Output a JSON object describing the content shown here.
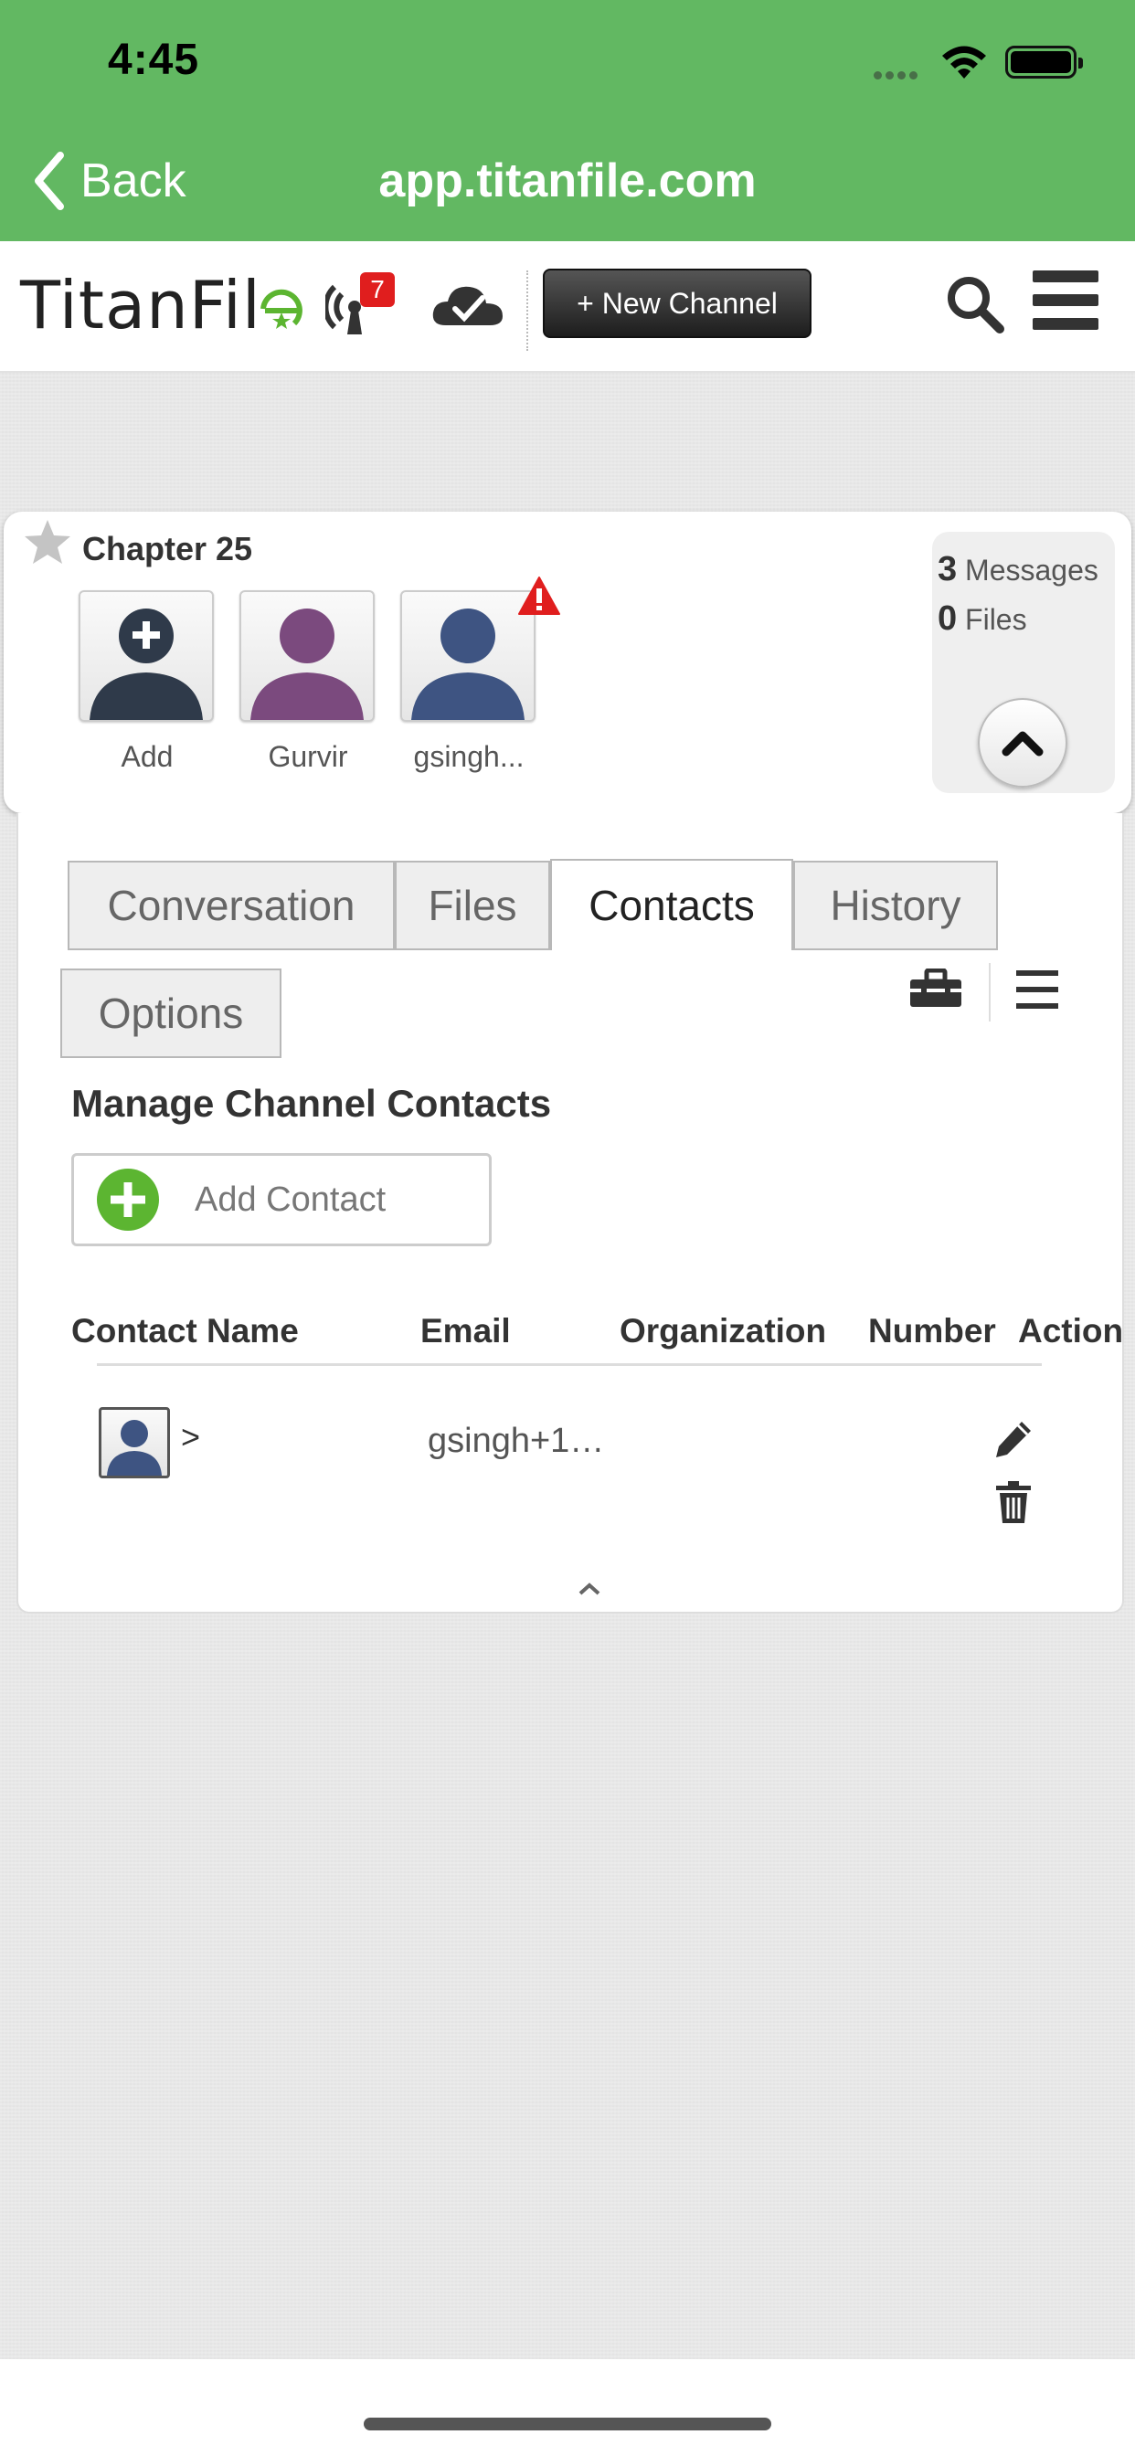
{
  "status_bar": {
    "time": "4:45"
  },
  "nav": {
    "back_label": "Back",
    "title": "app.titanfile.com"
  },
  "header": {
    "logo_text": "TitanFil",
    "notification_count": "7",
    "new_channel_label": "+ New Channel",
    "icons": [
      "broadcast-icon",
      "cloud-check-icon",
      "search-icon",
      "hamburger-menu-icon"
    ]
  },
  "channel": {
    "title": "Chapter 25",
    "members": [
      {
        "name": "Add",
        "icon": "add-member-avatar",
        "color": "#2f3a4a"
      },
      {
        "name": "Gurvir",
        "icon": "person-avatar",
        "color": "#7b4a7e"
      },
      {
        "name": "gsingh...",
        "icon": "person-avatar",
        "color": "#3e5482",
        "alert": true
      }
    ],
    "stats": {
      "messages_count": "3",
      "messages_label": "Messages",
      "files_count": "0",
      "files_label": "Files"
    }
  },
  "tabs": [
    {
      "label": "Conversation",
      "active": false
    },
    {
      "label": "Files",
      "active": false
    },
    {
      "label": "Contacts",
      "active": true
    },
    {
      "label": "History",
      "active": false
    },
    {
      "label": "Options",
      "active": false
    }
  ],
  "contacts": {
    "section_title": "Manage Channel Contacts",
    "add_button_label": "Add Contact",
    "columns": [
      "Contact Name",
      "Email",
      "Organization",
      "Number",
      "Action"
    ],
    "rows": [
      {
        "name": ">",
        "email": "gsingh+1…",
        "organization": "",
        "number": ""
      }
    ]
  },
  "colors": {
    "nav_green": "#62b862",
    "badge_red": "#e01e1e",
    "add_green": "#5cb531"
  }
}
